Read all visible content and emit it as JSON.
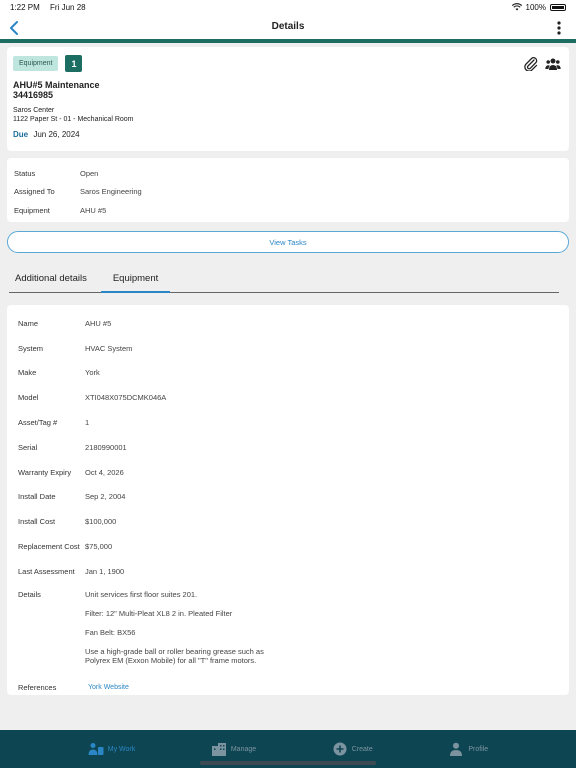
{
  "status_bar": {
    "time": "1:22 PM",
    "date": "Fri Jun 28",
    "battery": "100%"
  },
  "nav": {
    "title": "Details"
  },
  "header": {
    "type_chip": "Equipment",
    "count": "1",
    "title": "AHU#5 Maintenance",
    "number": "34416985",
    "site": "Saros Center",
    "address": "1122 Paper St - 01 - Mechanical Room",
    "due_label": "Due",
    "due_date": "Jun 26, 2024"
  },
  "summary": [
    {
      "label": "Status",
      "value": "Open"
    },
    {
      "label": "Assigned To",
      "value": "Saros Engineering"
    },
    {
      "label": "Equipment",
      "value": "AHU #5"
    }
  ],
  "view_tasks_label": "View Tasks",
  "tabs": [
    {
      "label": "Additional details"
    },
    {
      "label": "Equipment"
    }
  ],
  "equipment": [
    {
      "label": "Name",
      "value": "AHU #5"
    },
    {
      "label": "System",
      "value": "HVAC System"
    },
    {
      "label": "Make",
      "value": "York"
    },
    {
      "label": "Model",
      "value": "XTI048X075DCMK046A"
    },
    {
      "label": "Asset/Tag #",
      "value": "1"
    },
    {
      "label": "Serial",
      "value": "2180990001"
    },
    {
      "label": "Warranty Expiry",
      "value": "Oct 4, 2026"
    },
    {
      "label": "Install Date",
      "value": "Sep 2, 2004"
    },
    {
      "label": "Install Cost",
      "value": "$100,000"
    },
    {
      "label": "Replacement Cost",
      "value": "$75,000"
    },
    {
      "label": "Last Assessment",
      "value": "Jan 1, 1900"
    }
  ],
  "details": {
    "label": "Details",
    "lines": [
      "Unit services first floor suites 201.",
      "Filter: 12\" Multi-Pleat XL8 2 in. Pleated Filter",
      "Fan Belt: BX56",
      "Use a high-grade ball or roller bearing grease such as Polyrex EM (Exxon Mobile) for all \"T\" frame motors."
    ]
  },
  "references": {
    "label": "References",
    "link": "York Website"
  },
  "tab_bar": [
    {
      "label": "My Work",
      "icon": "person-checklist-icon"
    },
    {
      "label": "Manage",
      "icon": "building-icon"
    },
    {
      "label": "Create",
      "icon": "plus-circle-icon"
    },
    {
      "label": "Profile",
      "icon": "person-icon"
    }
  ],
  "colors": {
    "brand_teal": "#1b6e61",
    "link_blue": "#2b86c5",
    "tab_bar_bg": "#0e4552"
  }
}
